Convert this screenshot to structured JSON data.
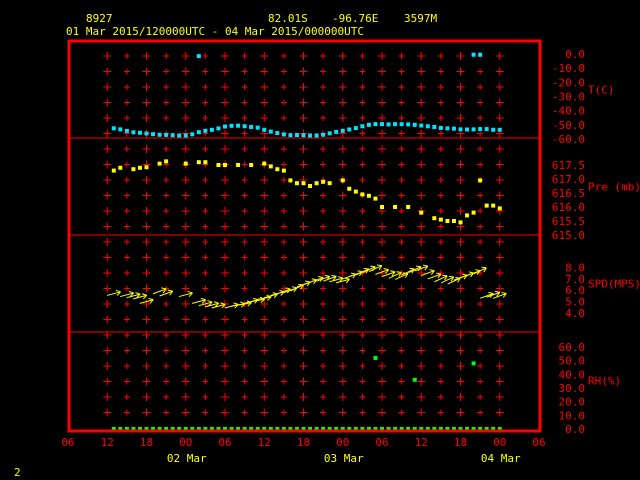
{
  "header": {
    "station_id": "8927",
    "lat": "82.01S",
    "lon": "-96.76E",
    "elev": "3597M",
    "period": "01 Mar 2015/120000UTC - 04 Mar 2015/000000UTC"
  },
  "footer": {
    "page_number": "2"
  },
  "colors": {
    "background": "#000000",
    "frame": "#ff0000",
    "labels": "#ff0000",
    "header_text": "#ffff00",
    "temp": "#00e5ff",
    "pressure": "#ffff00",
    "wind": "#ffff00",
    "rh": "#00ff00"
  },
  "chart_data": {
    "type": "scatter",
    "x_axis": {
      "ticks": [
        "06",
        "12",
        "18",
        "00",
        "06",
        "12",
        "18",
        "00",
        "06",
        "12",
        "18",
        "00",
        "06"
      ],
      "day_labels": [
        {
          "label": "02 Mar",
          "at_hour": 24
        },
        {
          "label": "03 Mar",
          "at_hour": 48
        },
        {
          "label": "04 Mar",
          "at_hour": 72
        }
      ],
      "range_hours": [
        6,
        78
      ]
    },
    "panels": [
      {
        "name": "T(C)",
        "range": [
          -60,
          0
        ],
        "tick_labels": [
          "0.0",
          "-10.0",
          "-20.0",
          "-30.0",
          "-40.0",
          "-50.0",
          "-60.0"
        ],
        "tick_values": [
          0,
          -10,
          -20,
          -30,
          -40,
          -50,
          -60
        ],
        "x": [
          13,
          14,
          15,
          16,
          17,
          18,
          19,
          20,
          21,
          22,
          23,
          24,
          25,
          26,
          27,
          28,
          29,
          30,
          31,
          32,
          33,
          34,
          35,
          36,
          37,
          38,
          39,
          40,
          41,
          42,
          43,
          44,
          45,
          46,
          47,
          48,
          49,
          50,
          51,
          52,
          53,
          54,
          55,
          56,
          57,
          58,
          59,
          60,
          61,
          62,
          63,
          64,
          65,
          66,
          67,
          68,
          69,
          70,
          71,
          72
        ],
        "values": [
          -52.5,
          -53.2,
          -54.3,
          -55.3,
          -55.6,
          -56.1,
          -56.6,
          -57.0,
          -57.1,
          -57.3,
          -57.5,
          -57.5,
          -56.7,
          -55.2,
          -54.2,
          -53.5,
          -52.5,
          -51.2,
          -50.7,
          -50.6,
          -51.0,
          -51.5,
          -52.0,
          -53.5,
          -54.8,
          -55.8,
          -56.8,
          -57.3,
          -57.2,
          -57.3,
          -57.5,
          -57.5,
          -57.0,
          -56.0,
          -55.0,
          -54.2,
          -53.3,
          -52.3,
          -51.0,
          -50.0,
          -49.5,
          -49.5,
          -49.7,
          -49.5,
          -49.5,
          -49.7,
          -50.0,
          -50.5,
          -51.0,
          -51.5,
          -52.2,
          -52.5,
          -52.7,
          -53.2,
          -53.3,
          -53.2,
          -53.0,
          -53.0,
          -53.5,
          -53.5
        ],
        "outliers": [
          {
            "x": 26,
            "value": -1.5
          },
          {
            "x": 68,
            "value": -0.5
          },
          {
            "x": 69,
            "value": -0.5
          }
        ],
        "color_key": "temp"
      },
      {
        "name": "Pre (mb)",
        "range": [
          615,
          618
        ],
        "tick_labels": [
          "617.5",
          "617.0",
          "616.5",
          "616.0",
          "615.5",
          "615.0"
        ],
        "tick_values": [
          617.5,
          617.0,
          616.5,
          616.0,
          615.5,
          615.0
        ],
        "x": [
          13,
          14,
          16,
          17,
          18,
          20,
          21,
          24,
          26,
          27,
          29,
          30,
          32,
          34,
          36,
          37,
          38,
          39,
          40,
          41,
          42,
          43,
          44,
          45,
          46,
          48,
          49,
          50,
          51,
          52,
          53,
          54,
          56,
          58,
          60,
          62,
          63,
          64,
          65,
          66,
          67,
          68,
          69,
          70,
          71,
          72
        ],
        "values": [
          617.3,
          617.4,
          617.35,
          617.4,
          617.42,
          617.55,
          617.63,
          617.55,
          617.6,
          617.6,
          617.5,
          617.5,
          617.5,
          617.5,
          617.55,
          617.45,
          617.35,
          617.3,
          616.95,
          616.85,
          616.85,
          616.75,
          616.85,
          616.9,
          616.85,
          616.95,
          616.65,
          616.55,
          616.45,
          616.4,
          616.3,
          616.0,
          616.0,
          616.0,
          615.8,
          615.6,
          615.55,
          615.5,
          615.5,
          615.45,
          615.7,
          615.8,
          616.95,
          616.05,
          616.05,
          615.95
        ],
        "color_key": "pressure"
      },
      {
        "name": "SPD(MPS)",
        "range": [
          4,
          9
        ],
        "tick_labels": [
          "8.0",
          "7.0",
          "6.0",
          "5.0",
          "4.0"
        ],
        "tick_values": [
          8.0,
          7.0,
          6.0,
          5.0,
          4.0
        ],
        "x": [
          13,
          15,
          16,
          17,
          18,
          20,
          21,
          24,
          26,
          27,
          28,
          29,
          31,
          32,
          33,
          34,
          35,
          36,
          37,
          38,
          39,
          40,
          41,
          42,
          43,
          44,
          45,
          46,
          47,
          48,
          49,
          50,
          51,
          52,
          53,
          54,
          55,
          56,
          57,
          58,
          59,
          60,
          61,
          62,
          63,
          64,
          65,
          66,
          67,
          68,
          69,
          70,
          71,
          72
        ],
        "values": [
          5.7,
          5.6,
          5.5,
          5.4,
          5.0,
          5.9,
          5.7,
          5.6,
          5.0,
          4.8,
          4.7,
          4.6,
          4.6,
          4.7,
          4.8,
          5.0,
          5.1,
          5.3,
          5.5,
          5.7,
          5.9,
          6.0,
          6.2,
          6.5,
          6.7,
          6.9,
          7.0,
          7.0,
          6.9,
          6.8,
          7.2,
          7.4,
          7.6,
          7.8,
          7.9,
          7.6,
          7.4,
          7.3,
          7.2,
          7.6,
          7.8,
          7.9,
          7.5,
          7.2,
          7.0,
          6.9,
          6.8,
          7.1,
          7.3,
          7.5,
          7.7,
          5.5,
          5.6,
          5.5
        ],
        "direction_deg": [
          255,
          255,
          255,
          255,
          255,
          250,
          250,
          255,
          255,
          255,
          255,
          255,
          255,
          260,
          260,
          255,
          260,
          260,
          255,
          255,
          250,
          250,
          245,
          250,
          250,
          250,
          250,
          250,
          255,
          255,
          250,
          250,
          245,
          245,
          245,
          250,
          250,
          245,
          245,
          245,
          245,
          250,
          250,
          250,
          245,
          245,
          245,
          250,
          250,
          250,
          245,
          250,
          250,
          250
        ],
        "color_key": "wind"
      },
      {
        "name": "RH(%)",
        "range": [
          0,
          60
        ],
        "tick_labels": [
          "60.0",
          "50.0",
          "40.0",
          "30.0",
          "20.0",
          "10.0",
          "0.0"
        ],
        "tick_values": [
          60.0,
          50.0,
          40.0,
          30.0,
          20.0,
          10.0,
          0.0
        ],
        "x": [
          13,
          14,
          15,
          16,
          17,
          18,
          19,
          20,
          21,
          22,
          23,
          24,
          25,
          26,
          27,
          28,
          29,
          30,
          31,
          32,
          33,
          34,
          35,
          36,
          37,
          38,
          39,
          40,
          41,
          42,
          43,
          44,
          45,
          46,
          47,
          48,
          49,
          50,
          51,
          52,
          53,
          54,
          55,
          56,
          57,
          58,
          59,
          60,
          61,
          62,
          63,
          64,
          65,
          66,
          67,
          68,
          69,
          70,
          71,
          72
        ],
        "values": [
          0,
          0,
          0,
          0,
          0,
          0,
          0,
          0,
          0,
          0,
          0,
          0,
          0,
          0,
          0,
          0,
          0,
          0,
          0,
          0,
          0,
          0,
          0,
          0,
          0,
          0,
          0,
          0,
          0,
          0,
          0,
          0,
          0,
          0,
          0,
          0,
          0,
          0,
          0,
          0,
          0,
          0,
          0,
          0,
          0,
          0,
          0,
          0,
          0,
          0,
          0,
          0,
          0,
          0,
          0,
          0,
          0,
          0,
          0,
          0
        ],
        "outliers": [
          {
            "x": 53,
            "value": 52
          },
          {
            "x": 59,
            "value": 36
          },
          {
            "x": 68,
            "value": 48
          }
        ],
        "color_key": "rh"
      }
    ]
  }
}
